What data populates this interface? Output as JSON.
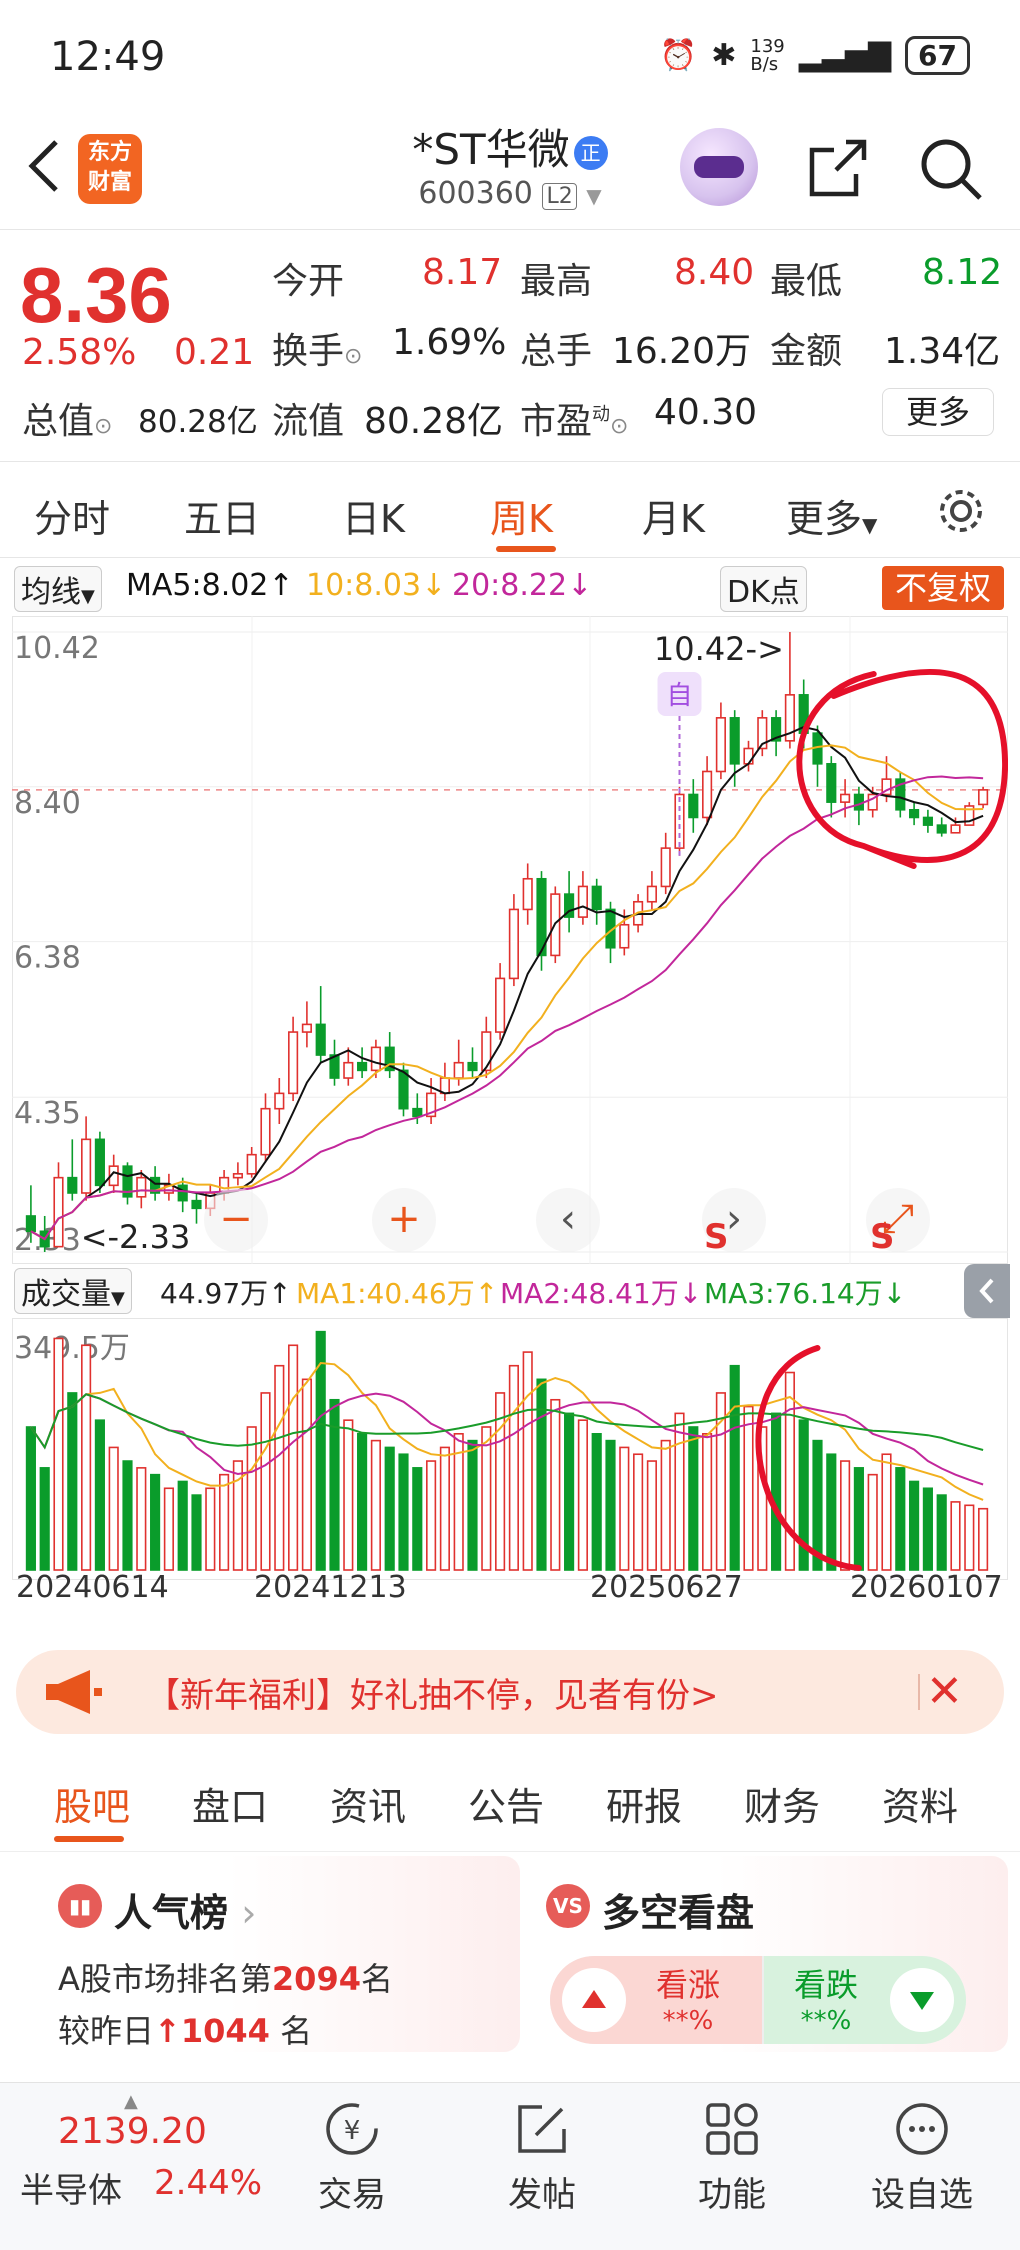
{
  "status": {
    "time": "12:49",
    "net": "139\nB/s",
    "battery": "67"
  },
  "header": {
    "name": "*ST华微",
    "name_badge": "正",
    "code": "600360",
    "level": "L2",
    "logo": "东方\n财富"
  },
  "quote": {
    "price": "8.36",
    "pct": "2.58%",
    "change": "0.21",
    "open_label": "今开",
    "open": "8.17",
    "high_label": "最高",
    "high": "8.40",
    "low_label": "最低",
    "low": "8.12",
    "turnover_label": "换手",
    "turnover": "1.69%",
    "volume_label": "总手",
    "volume": "16.20万",
    "amount_label": "金额",
    "amount": "1.34亿",
    "mktcap_label": "总值",
    "mktcap": "80.28亿",
    "float_label": "流值",
    "float": "80.28亿",
    "pe_label": "市盈",
    "pe_sup": "动",
    "pe": "40.30",
    "more": "更多"
  },
  "period_tabs": [
    "分时",
    "五日",
    "日K",
    "周K",
    "月K",
    "更多"
  ],
  "active_period": "周K",
  "ma_legend": {
    "chip": "均线",
    "ma5": "MA5:8.02↑",
    "ma10": "10:8.03↓",
    "ma20": "20:8.22↓",
    "dk": "DK点",
    "fq": "不复权"
  },
  "vol_legend": {
    "chip": "成交量",
    "vol": "44.97万↑",
    "ma1": "MA1:40.46万↑",
    "ma2": "MA2:48.41万↓",
    "ma3": "MA3:76.14万↓"
  },
  "colors": {
    "up": "#e0312e",
    "down": "#0a9c2b",
    "ma5": "#111111",
    "ma10": "#f2b01e",
    "ma20": "#c2279b",
    "vma3": "#1a9c2a",
    "accent": "#e8551c",
    "annot": "#e5102a"
  },
  "chart_data": {
    "type": "candlestick",
    "title": "*ST华微 周K",
    "y_ticks": [
      "10.42",
      "8.40",
      "6.38",
      "4.35",
      "2.33"
    ],
    "ylim": [
      2.33,
      10.42
    ],
    "max_label": "10.42->",
    "min_label": "2.33",
    "marker": "自",
    "x_dates": [
      "20240614",
      "20241213",
      "20250627",
      "20260107"
    ],
    "vol_tick": "349.5万",
    "candles": [
      [
        2.8,
        2.6,
        3.2,
        2.45
      ],
      [
        2.6,
        2.4,
        2.8,
        2.33
      ],
      [
        2.4,
        3.3,
        3.5,
        2.4
      ],
      [
        3.3,
        3.1,
        3.8,
        3.0
      ],
      [
        3.1,
        3.8,
        4.1,
        3.0
      ],
      [
        3.8,
        3.2,
        3.9,
        3.1
      ],
      [
        3.2,
        3.45,
        3.6,
        3.1
      ],
      [
        3.45,
        3.05,
        3.5,
        2.95
      ],
      [
        3.05,
        3.3,
        3.4,
        2.9
      ],
      [
        3.3,
        3.1,
        3.45,
        3.0
      ],
      [
        3.1,
        3.2,
        3.35,
        3.0
      ],
      [
        3.2,
        3.0,
        3.3,
        2.85
      ],
      [
        3.0,
        2.9,
        3.1,
        2.7
      ],
      [
        2.9,
        3.1,
        3.2,
        2.8
      ],
      [
        3.1,
        3.3,
        3.4,
        3.0
      ],
      [
        3.3,
        3.35,
        3.5,
        3.2
      ],
      [
        3.35,
        3.6,
        3.7,
        3.3
      ],
      [
        3.6,
        4.2,
        4.4,
        3.5
      ],
      [
        4.2,
        4.4,
        4.6,
        4.0
      ],
      [
        4.4,
        5.2,
        5.4,
        4.3
      ],
      [
        5.2,
        5.3,
        5.6,
        5.0
      ],
      [
        5.3,
        4.9,
        5.8,
        4.8
      ],
      [
        4.9,
        4.6,
        5.1,
        4.5
      ],
      [
        4.6,
        4.8,
        5.0,
        4.5
      ],
      [
        4.8,
        4.7,
        5.0,
        4.6
      ],
      [
        4.7,
        5.0,
        5.1,
        4.6
      ],
      [
        5.0,
        4.7,
        5.2,
        4.6
      ],
      [
        4.7,
        4.2,
        4.8,
        4.1
      ],
      [
        4.2,
        4.1,
        4.4,
        4.0
      ],
      [
        4.1,
        4.4,
        4.6,
        4.0
      ],
      [
        4.4,
        4.6,
        4.8,
        4.3
      ],
      [
        4.6,
        4.8,
        5.1,
        4.5
      ],
      [
        4.8,
        4.7,
        5.0,
        4.6
      ],
      [
        4.7,
        5.2,
        5.4,
        4.6
      ],
      [
        5.2,
        5.9,
        6.1,
        5.1
      ],
      [
        5.9,
        6.8,
        7.0,
        5.8
      ],
      [
        6.8,
        7.2,
        7.4,
        6.6
      ],
      [
        7.2,
        6.2,
        7.3,
        6.0
      ],
      [
        6.2,
        7.0,
        7.1,
        6.1
      ],
      [
        7.0,
        6.7,
        7.3,
        6.5
      ],
      [
        6.7,
        7.1,
        7.3,
        6.6
      ],
      [
        7.1,
        6.8,
        7.2,
        6.6
      ],
      [
        6.8,
        6.3,
        6.9,
        6.1
      ],
      [
        6.3,
        6.6,
        6.8,
        6.2
      ],
      [
        6.6,
        6.9,
        7.0,
        6.5
      ],
      [
        6.9,
        7.1,
        7.3,
        6.8
      ],
      [
        7.1,
        7.6,
        7.8,
        7.0
      ],
      [
        7.6,
        8.3,
        8.4,
        7.5
      ],
      [
        8.3,
        8.0,
        8.5,
        7.8
      ],
      [
        8.0,
        8.6,
        8.8,
        7.9
      ],
      [
        8.6,
        9.3,
        9.5,
        8.5
      ],
      [
        9.3,
        8.7,
        9.4,
        8.4
      ],
      [
        8.7,
        8.9,
        9.0,
        8.6
      ],
      [
        8.9,
        9.3,
        9.4,
        8.8
      ],
      [
        9.3,
        9.0,
        9.4,
        8.8
      ],
      [
        9.0,
        9.6,
        10.42,
        8.9
      ],
      [
        9.6,
        9.1,
        9.8,
        8.9
      ],
      [
        9.1,
        8.7,
        9.2,
        8.4
      ],
      [
        8.7,
        8.2,
        8.8,
        8.0
      ],
      [
        8.2,
        8.3,
        8.5,
        8.0
      ],
      [
        8.3,
        8.1,
        8.4,
        7.9
      ],
      [
        8.1,
        8.3,
        8.4,
        8.0
      ],
      [
        8.3,
        8.5,
        8.8,
        8.2
      ],
      [
        8.5,
        8.1,
        8.6,
        8.0
      ],
      [
        8.1,
        8.0,
        8.2,
        7.9
      ],
      [
        8.0,
        7.9,
        8.1,
        7.8
      ],
      [
        7.9,
        7.8,
        8.0,
        7.75
      ],
      [
        7.8,
        7.9,
        8.0,
        7.8
      ],
      [
        7.9,
        8.15,
        8.2,
        7.9
      ],
      [
        8.17,
        8.36,
        8.4,
        8.12
      ]
    ],
    "volumes": [
      210,
      150,
      340,
      260,
      330,
      220,
      180,
      160,
      150,
      140,
      120,
      130,
      110,
      120,
      140,
      160,
      210,
      260,
      300,
      330,
      280,
      350,
      250,
      220,
      200,
      190,
      180,
      170,
      150,
      160,
      180,
      200,
      190,
      210,
      260,
      300,
      320,
      280,
      250,
      230,
      220,
      200,
      190,
      180,
      170,
      160,
      190,
      230,
      210,
      200,
      260,
      300,
      240,
      210,
      230,
      290,
      220,
      190,
      170,
      160,
      150,
      140,
      170,
      150,
      130,
      120,
      110,
      100,
      95,
      90
    ]
  },
  "banner": {
    "text": "【新年福利】好礼抽不停，见者有份>"
  },
  "section_tabs": [
    "股吧",
    "盘口",
    "资讯",
    "公告",
    "研报",
    "财务",
    "资料"
  ],
  "cards": {
    "popularity": {
      "title": "人气榜",
      "line1_pre": "A股市场排名第",
      "rank": "2094",
      "line1_post": "名",
      "line2_pre": "较昨日",
      "delta": "1044",
      "line2_post": "名"
    },
    "sentiment": {
      "title": "多空看盘",
      "icon": "VS",
      "up_label": "看涨",
      "up_val": "**%",
      "down_label": "看跌",
      "down_val": "**%"
    }
  },
  "bottom_bar": {
    "index_value": "2139.20",
    "index_name": "半导体",
    "index_change": "2.44%",
    "items": [
      "交易",
      "发帖",
      "功能",
      "设自选"
    ]
  }
}
